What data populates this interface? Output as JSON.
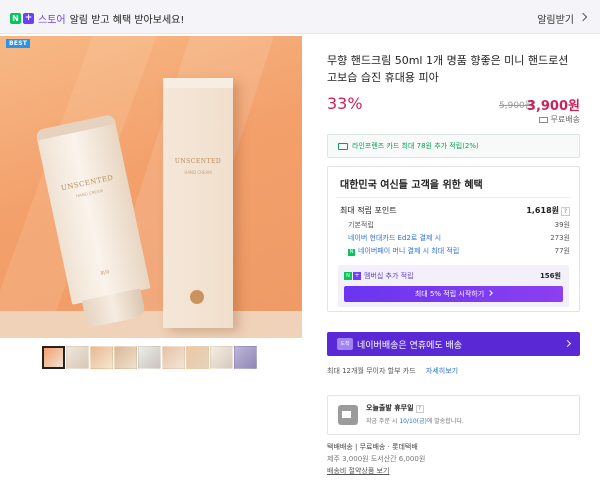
{
  "topbar": {
    "n_badge": "N",
    "plus_badge": "+",
    "store_label": "스토어",
    "message": "알림 받고 혜택 받아보세요!",
    "notify_label": "알림받기"
  },
  "product": {
    "best_badge": "BEST",
    "box_brand": "UNSCENTED",
    "box_sub": "HAND CREAM",
    "tube_brand": "UNSCENTED",
    "tube_sub": "HAND CREAM",
    "tube_mark": "피아",
    "title": "무향 핸드크림 50ml 1개 명품 향좋은 미니 핸드로션 고보습 습진 휴대용 피아",
    "discount": "33%",
    "original_price": "5,900원",
    "sale_price": "3,900원",
    "shipping": "무료배송",
    "thumbnail_count": 9
  },
  "card_banner": "라인프렌즈 카드 최대 78원 추가 적립(2%)",
  "benefit": {
    "heading": "대한민국 여신들 고객을 위한 혜택",
    "max_points_label": "최대 적립 포인트",
    "max_points_value": "1,618원",
    "q": "?",
    "rows": [
      {
        "label": "기본적립",
        "value": "39원"
      },
      {
        "label": "네이버 현대카드 Ed2로 결제 시",
        "value": "273원"
      },
      {
        "label": "네이버페이 머니 결제 시 최대 적립",
        "value": "77원"
      }
    ],
    "npay_mark": "N",
    "membership_label": "멤버십 추가 적립",
    "membership_value": "156원",
    "membership_button": "최대 5% 적립 시작하기"
  },
  "naver_delivery": {
    "icon_text": "도착",
    "text": "네이버배송은 연휴에도 배송"
  },
  "installment": {
    "text": "최대 12개월 무이자 할부 카드",
    "link": "자세히보기"
  },
  "today_ship": {
    "title": "오늘출발 휴무일",
    "q": "?",
    "text_prefix": "지금 주문 시",
    "text_date": "10/10(금)",
    "text_suffix": "에 발송합니다."
  },
  "delivery": {
    "line1": "택배배송 | 무료배송 · 롯데택배",
    "line2": "제주 3,000원 도서산간 6,000원",
    "link": "배송비 절약상품 보기"
  },
  "colors": {
    "accent_red": "#c8245a",
    "naver_green": "#03c75a",
    "purple": "#6f3ff5",
    "link_blue": "#2c6fd9"
  }
}
